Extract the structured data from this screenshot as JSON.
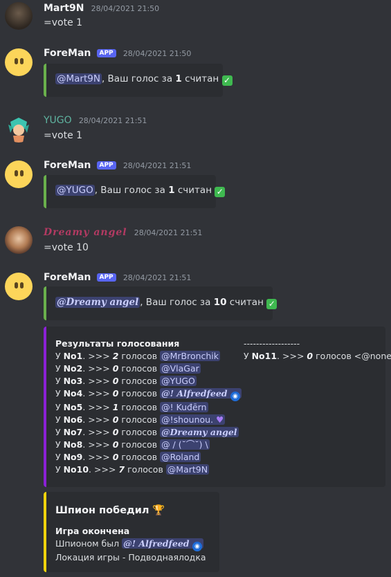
{
  "messages": [
    {
      "author": "Mart9N",
      "timestamp": "28/04/2021 21:50",
      "text": "=vote 1"
    },
    {
      "author": "ForeMan",
      "tag": "APP",
      "timestamp": "28/04/2021 21:50",
      "embed": {
        "mention": "@Mart9N",
        "pre": ", Ваш голос за ",
        "num": "1",
        "post": " считан",
        "emoji": "✓"
      }
    },
    {
      "author": "YUGO",
      "timestamp": "28/04/2021 21:51",
      "text": "=vote 1"
    },
    {
      "author": "ForeMan",
      "tag": "APP",
      "timestamp": "28/04/2021 21:51",
      "embed": {
        "mention": "@YUGO",
        "pre": ", Ваш голос за ",
        "num": "1",
        "post": " считан",
        "emoji": "✓"
      }
    },
    {
      "author": "Dreamy angel",
      "timestamp": "28/04/2021 21:51",
      "text": "=vote 10"
    },
    {
      "author": "ForeMan",
      "tag": "APP",
      "timestamp": "28/04/2021 21:51",
      "embed": {
        "mention": "@Dreamy angel",
        "pre": ", Ваш голос за ",
        "num": "10",
        "post": " считан",
        "emoji": "✓"
      }
    }
  ],
  "results": {
    "title": "Результаты голосования",
    "rows": [
      {
        "pre": "У ",
        "no": "No1",
        "mid": ". >>> ",
        "count": "2",
        "unit": " голосов ",
        "mention": "@MrBronchik"
      },
      {
        "pre": "У ",
        "no": "No2",
        "mid": ". >>> ",
        "count": "0",
        "unit": " голосов ",
        "mention": "@VlaGar"
      },
      {
        "pre": "У ",
        "no": "No3",
        "mid": ". >>> ",
        "count": "0",
        "unit": " голосов ",
        "mention": "@YUGO"
      },
      {
        "pre": "У ",
        "no": "No4",
        "mid": ". >>> ",
        "count": "0",
        "unit": " голосов ",
        "mention": "@! Alfredfeed"
      },
      {
        "pre": "У ",
        "no": "No5",
        "mid": ". >>> ",
        "count": "1",
        "unit": " голосов ",
        "mention": "@! Kuđērn"
      },
      {
        "pre": "У ",
        "no": "No6",
        "mid": ". >>> ",
        "count": "0",
        "unit": " голосов ",
        "mention": "@!ꜱhounou."
      },
      {
        "pre": "У ",
        "no": "No7",
        "mid": ". >>> ",
        "count": "0",
        "unit": " голосов ",
        "mention": "@Dreamy angel"
      },
      {
        "pre": "У ",
        "no": "No8",
        "mid": ". >>> ",
        "count": "0",
        "unit": " голосов ",
        "mention": "@ / (˘⌒˘) \\"
      },
      {
        "pre": "У ",
        "no": "No9",
        "mid": ". >>> ",
        "count": "0",
        "unit": " голосов ",
        "mention": "@Roland"
      },
      {
        "pre": "У ",
        "no": "No10",
        "mid": ". >>> ",
        "count": "7",
        "unit": " голосов ",
        "mention": "@Mart9N"
      }
    ],
    "separator": "------------------",
    "extra": {
      "pre": "У ",
      "no": "No11",
      "mid": ". >>> ",
      "count": "0",
      "unit": " голосов ",
      "mention": "<@none>"
    }
  },
  "spy": {
    "title": "Шпион победил",
    "title_emoji": "🏆",
    "subtitle": "Игра окончена",
    "spy_label": "Шпионом был ",
    "spy_mention": "@! Alfredfeed",
    "location": "Локация игры - Подводнаялодка"
  }
}
